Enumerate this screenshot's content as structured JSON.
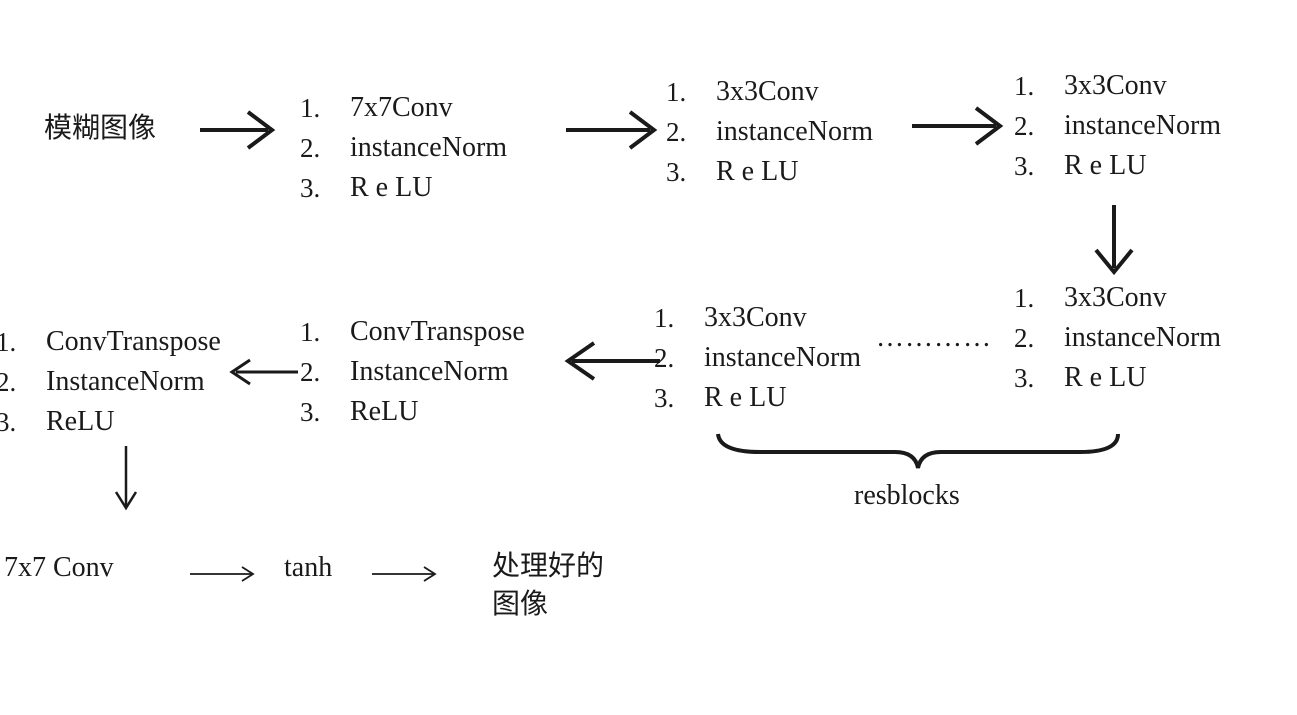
{
  "input_label": "模糊图像",
  "output_label": [
    "处理好的",
    "图像"
  ],
  "numbers": [
    "1.",
    "2.",
    "3."
  ],
  "blocks": {
    "b1": [
      "7x7Conv",
      "instanceNorm",
      "R e LU"
    ],
    "b2": [
      "3x3Conv",
      "instanceNorm",
      "R e LU"
    ],
    "b3": [
      "3x3Conv",
      "instanceNorm",
      "R e LU"
    ],
    "b4": [
      "3x3Conv",
      "instanceNorm",
      "R e LU"
    ],
    "b5": [
      "3x3Conv",
      "instanceNorm",
      "R e LU"
    ],
    "b6": [
      "ConvTranspose",
      "InstanceNorm",
      "ReLU"
    ],
    "b7": [
      "ConvTranspose",
      "InstanceNorm",
      "ReLU"
    ]
  },
  "resblocks_label": "resblocks",
  "ellipsis": "…………",
  "final": {
    "conv": "7x7 Conv",
    "tanh": "tanh"
  }
}
